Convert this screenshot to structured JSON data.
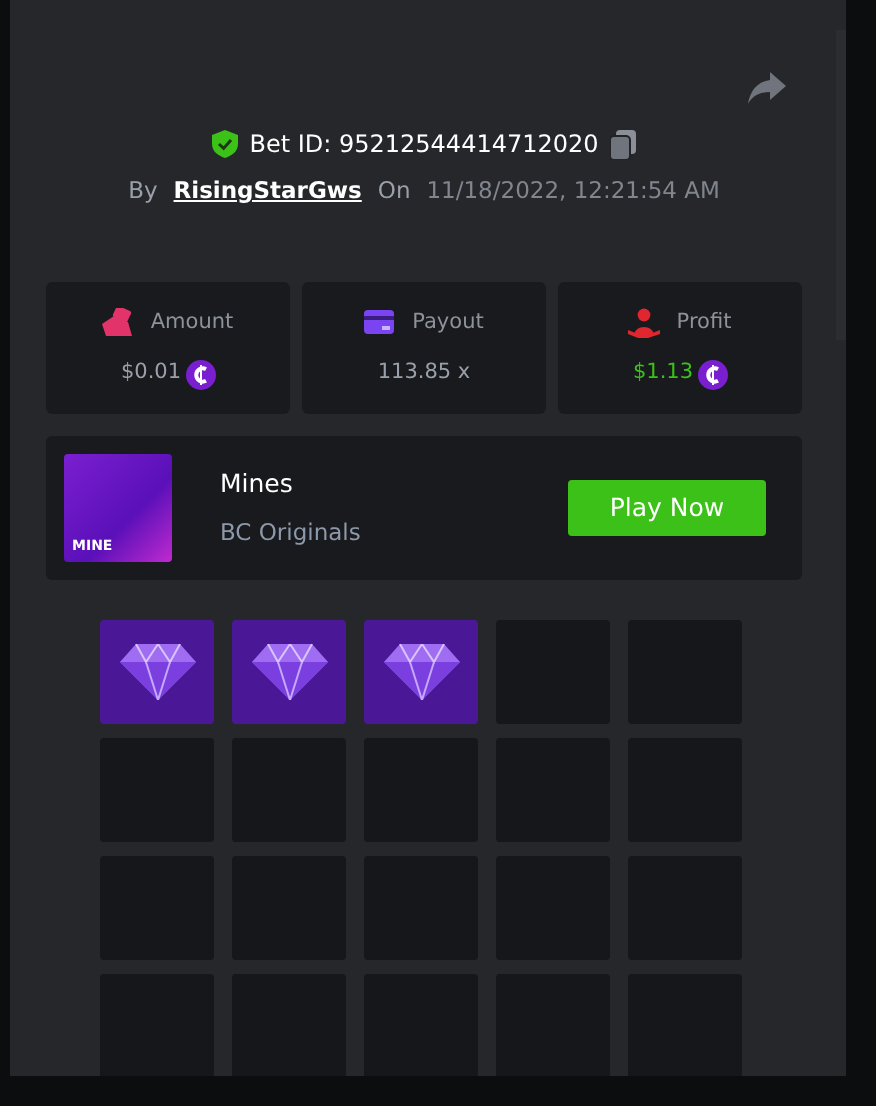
{
  "bet": {
    "label": "Bet ID:",
    "id": "95212544414712020",
    "by_label": "By",
    "user": "RisingStarGws",
    "on_label": "On",
    "datetime": "11/18/2022, 12:21:54 AM"
  },
  "stats": [
    {
      "kind": "amount",
      "label": "Amount",
      "value": "$0.01",
      "coin": true,
      "positive": false
    },
    {
      "kind": "payout",
      "label": "Payout",
      "value": "113.85 x",
      "coin": false,
      "positive": false
    },
    {
      "kind": "profit",
      "label": "Profit",
      "value": "$1.13",
      "coin": true,
      "positive": true
    }
  ],
  "game": {
    "name": "Mines",
    "provider": "BC Originals",
    "thumb_label": "MINE",
    "button": "Play Now"
  },
  "tiles": [
    {
      "revealed": true
    },
    {
      "revealed": true
    },
    {
      "revealed": true
    },
    {
      "revealed": false
    },
    {
      "revealed": false
    },
    {
      "revealed": false
    },
    {
      "revealed": false
    },
    {
      "revealed": false
    },
    {
      "revealed": false
    },
    {
      "revealed": false
    },
    {
      "revealed": false
    },
    {
      "revealed": false
    },
    {
      "revealed": false
    },
    {
      "revealed": false
    },
    {
      "revealed": false
    },
    {
      "revealed": false
    },
    {
      "revealed": false
    },
    {
      "revealed": false
    },
    {
      "revealed": false
    },
    {
      "revealed": false
    }
  ]
}
